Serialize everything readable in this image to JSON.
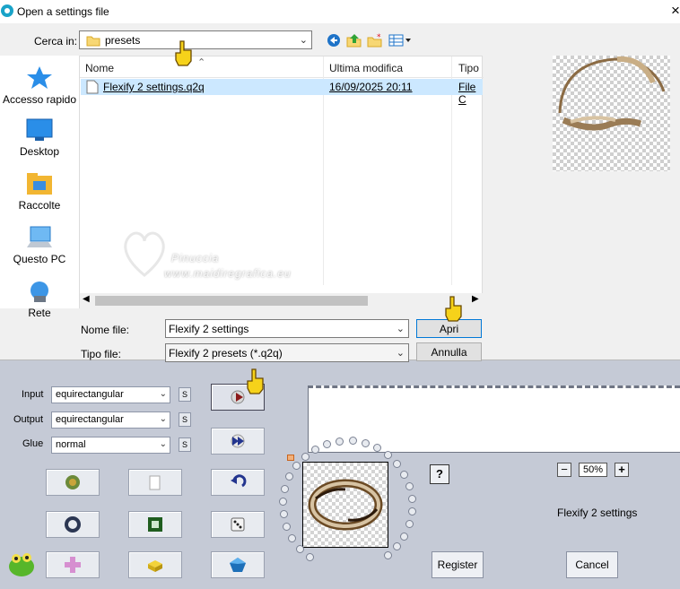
{
  "dialog": {
    "title": "Open a settings file",
    "close_glyph": "×",
    "look_in_label": "Cerca in:",
    "look_in_value": "presets",
    "places": [
      {
        "label": "Accesso rapido",
        "icon": "star-icon"
      },
      {
        "label": "Desktop",
        "icon": "desktop-icon"
      },
      {
        "label": "Raccolte",
        "icon": "library-folder-icon"
      },
      {
        "label": "Questo PC",
        "icon": "computer-icon"
      },
      {
        "label": "Rete",
        "icon": "network-icon"
      }
    ],
    "columns": {
      "name": "Nome",
      "modified": "Ultima modifica",
      "type": "Tipo"
    },
    "files": [
      {
        "name": "Flexify 2 settings.q2q",
        "modified": "16/09/2025 20:11",
        "type": "File C"
      }
    ],
    "file_name_label": "Nome file:",
    "file_name_value": "Flexify 2 settings",
    "file_type_label": "Tipo file:",
    "file_type_value": "Flexify 2 presets (*.q2q)",
    "open_button": "Apri",
    "cancel_button": "Annulla",
    "watermark_line1": "Pinuccia",
    "watermark_line2": "www.maidiregrafica.eu"
  },
  "plugin": {
    "input_label": "Input",
    "input_value": "equirectangular",
    "output_label": "Output",
    "output_value": "equirectangular",
    "glue_label": "Glue",
    "glue_value": "normal",
    "s_label": "S",
    "help_label": "?",
    "zoom_minus": "−",
    "zoom_value": "50%",
    "zoom_plus": "+",
    "settings_name": "Flexify 2 settings",
    "register_button": "Register",
    "cancel_button": "Cancel"
  },
  "colors": {
    "selection": "#cce8ff",
    "accent": "#0078d7",
    "plugin_bg": "#c5cad6"
  }
}
